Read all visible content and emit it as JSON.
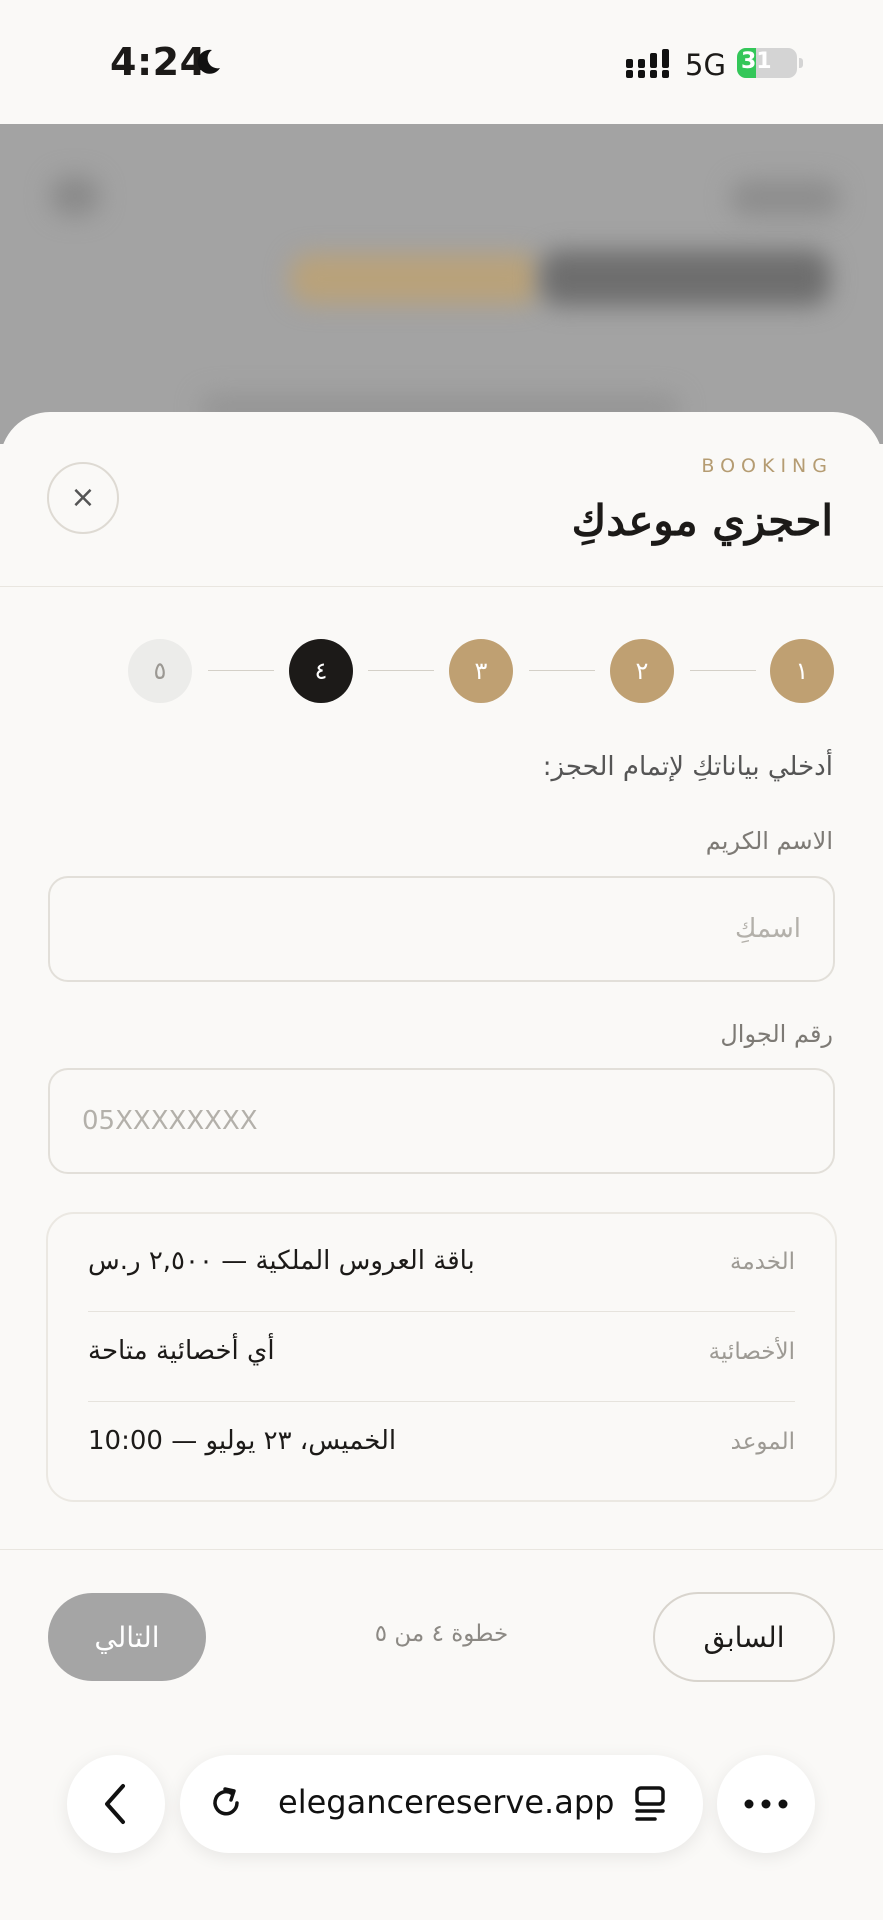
{
  "status_bar": {
    "time": "4:24",
    "network": "5G",
    "battery": "31",
    "battery_level": 0.31
  },
  "sheet": {
    "eyebrow": "BOOKING",
    "title": "احجزي موعدكِ",
    "close_icon": "×"
  },
  "stepper": {
    "steps": [
      {
        "label": "١",
        "state": "done"
      },
      {
        "label": "٢",
        "state": "done"
      },
      {
        "label": "٣",
        "state": "done"
      },
      {
        "label": "٤",
        "state": "active"
      },
      {
        "label": "٥",
        "state": "pending"
      }
    ]
  },
  "form": {
    "intro": "أدخلي بياناتكِ لإتمام الحجز:",
    "name_label": "الاسم الكريم",
    "name_placeholder": "اسمكِ",
    "name_value": "",
    "phone_label": "رقم الجوال",
    "phone_placeholder": "05XXXXXXXX",
    "phone_value": ""
  },
  "summary": {
    "rows": [
      {
        "label": "الخدمة",
        "value": "باقة العروس الملكية — ٢,٥٠٠ ر.س"
      },
      {
        "label": "الأخصائية",
        "value": "أي أخصائية متاحة"
      },
      {
        "label": "الموعد",
        "value": "الخميس، ٢٣ يوليو — 10:00"
      }
    ]
  },
  "footer": {
    "prev_label": "السابق",
    "next_label": "التالي",
    "step_counter": "خطوة ٤ من ٥"
  },
  "browser": {
    "url": "elegancereserve.app",
    "back_icon": "chevron-left-icon",
    "reload_icon": "reload-icon",
    "tabs_icon": "reader-icon",
    "more_icon": "more-icon"
  },
  "colors": {
    "accent": "#bfa072",
    "active": "#1c1a18",
    "disabled_button": "#a5a5a5"
  }
}
